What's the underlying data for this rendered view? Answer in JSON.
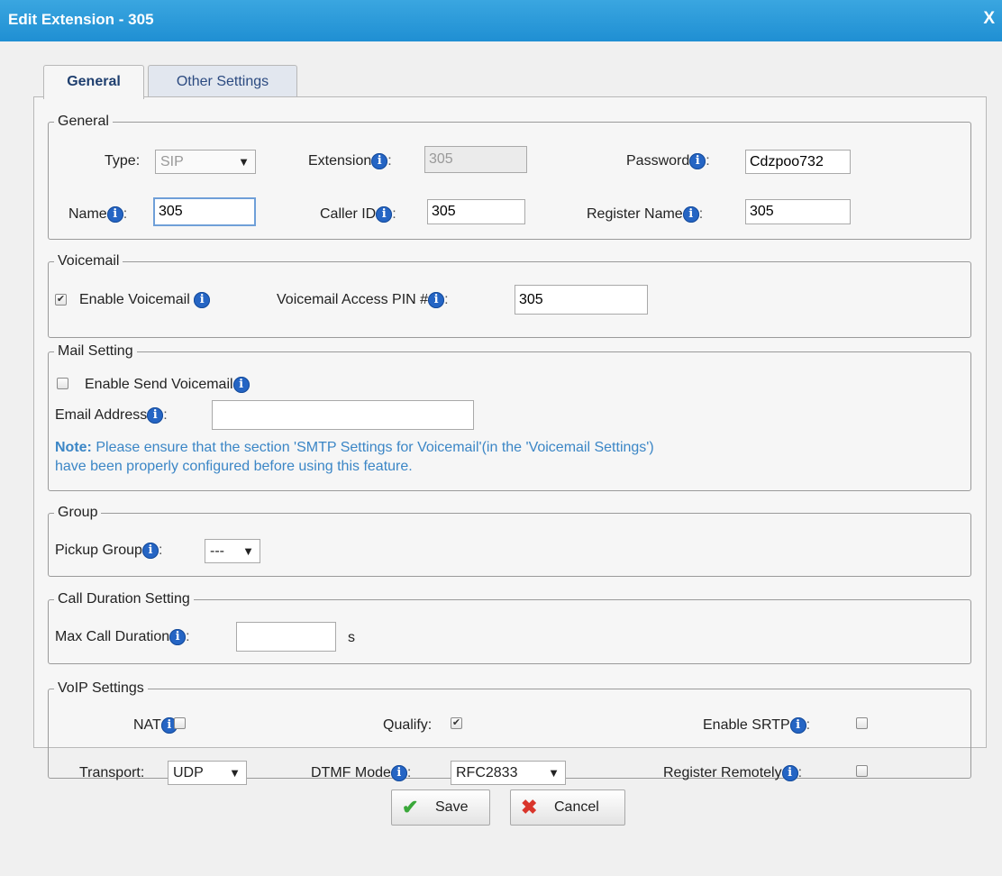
{
  "window": {
    "title": "Edit Extension - 305",
    "close_label": "X"
  },
  "tabs": [
    {
      "label": "General"
    },
    {
      "label": "Other Settings"
    }
  ],
  "general": {
    "legend": "General",
    "type_label": "Type:",
    "type_value": "SIP",
    "extension_label": "Extension",
    "extension_value": "305",
    "password_label": "Password",
    "password_value": "Cdzpoo732",
    "name_label": "Name",
    "name_value": "305",
    "caller_id_label": "Caller ID",
    "caller_id_value": "305",
    "register_name_label": "Register Name",
    "register_name_value": "305"
  },
  "voicemail": {
    "legend": "Voicemail",
    "enable_label": "Enable Voicemail",
    "enable_checked": true,
    "pin_label": "Voicemail Access PIN #",
    "pin_value": "305"
  },
  "mail": {
    "legend": "Mail Setting",
    "enable_send_label": "Enable Send Voicemail",
    "enable_send_checked": false,
    "email_label": "Email Address",
    "email_value": "",
    "note_bold": "Note:",
    "note_line1": " Please ensure that the section 'SMTP Settings for Voicemail'(in the 'Voicemail Settings')",
    "note_line2": "have been properly configured before using this feature."
  },
  "group": {
    "legend": "Group",
    "pickup_label": "Pickup Group",
    "pickup_value": "---"
  },
  "call_duration": {
    "legend": "Call Duration Setting",
    "max_label": "Max Call Duration",
    "max_value": "",
    "unit": "s"
  },
  "voip": {
    "legend": "VoIP Settings",
    "nat_label": "NAT",
    "nat_checked": false,
    "qualify_label": "Qualify:",
    "qualify_checked": true,
    "srtp_label": "Enable SRTP",
    "srtp_checked": false,
    "transport_label": "Transport:",
    "transport_value": "UDP",
    "dtmf_label": "DTMF Mode",
    "dtmf_value": "RFC2833",
    "register_remotely_label": "Register Remotely",
    "register_remotely_checked": false
  },
  "buttons": {
    "save_label": "Save",
    "cancel_label": "Cancel"
  },
  "colors": {
    "titlebar": "#1f8fd3",
    "note": "#3b86c6",
    "info_icon": "#2565c4",
    "save_icon": "#3aa83a",
    "cancel_icon": "#d9352b"
  },
  "icons": {
    "info": "info-icon",
    "close": "close-icon",
    "save": "checkmark-icon",
    "cancel": "x-icon"
  }
}
